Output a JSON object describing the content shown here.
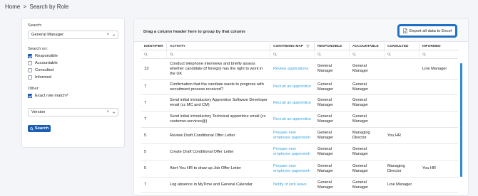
{
  "breadcrumb": {
    "home": "Home",
    "separator": ">",
    "current": "Search by Role"
  },
  "search_panel": {
    "search_label": "Search:",
    "role_select": {
      "value": "General Manager",
      "clear": "×"
    },
    "search_on_label": "Search on:",
    "options": [
      {
        "label": "Responsible",
        "checked": true
      },
      {
        "label": "Accountable",
        "checked": false
      },
      {
        "label": "Consulted",
        "checked": false
      },
      {
        "label": "Informed",
        "checked": false
      }
    ],
    "other_label": "Other:",
    "exact_match": {
      "label": "Exact role match?",
      "checked": true
    },
    "version_select": {
      "value": "Version",
      "clear": "×"
    },
    "search_button": "Search"
  },
  "grid": {
    "group_hint": "Drag a column header here to group by that column",
    "export_label": "Export all data to Excel",
    "columns": [
      "IDENTIFIER",
      "ACTIVITY",
      "CONTAINING MAP",
      "RESPONSIBLE",
      "ACCOUNTABLE",
      "CONSULTED",
      "INFORMED"
    ],
    "rows": [
      {
        "id": "13",
        "activity": "Conduct telephone interviews and briefly assess whether candidate (if foreign) has the right to work in the UK",
        "map": "Review applications",
        "responsible": "General Manager",
        "accountable": "General Manager",
        "consulted": "",
        "informed": "Line Manager"
      },
      {
        "id": "7",
        "activity": "Confirmation that the candiate wants to progress with recruitment process received?",
        "map": "Recruit an apprentice",
        "responsible": "General Manager",
        "accountable": "General Manager",
        "consulted": "",
        "informed": ""
      },
      {
        "id": "7",
        "activity": "Send initial introductory Apprentice Software Developer email (cc MC and CM)",
        "map": "Recruit an apprentice",
        "responsible": "General Manager",
        "accountable": "General Manager",
        "consulted": "",
        "informed": ""
      },
      {
        "id": "7",
        "activity": "Send initial introductory Technical apprentice email (cc customer.services@)",
        "map": "Recruit an apprentice",
        "responsible": "General Manager",
        "accountable": "General Manager",
        "consulted": "",
        "informed": ""
      },
      {
        "id": "5",
        "activity": "Review Draft Conditional Offer Letter",
        "map": "Prepare new employee paperwork",
        "responsible": "General Manager",
        "accountable": "Managing Director",
        "consulted": "You HR",
        "informed": ""
      },
      {
        "id": "5",
        "activity": "Create Draft Conditional Offer Letter",
        "map": "Prepare new employee paperwork",
        "responsible": "General Manager",
        "accountable": "General Manager",
        "consulted": "",
        "informed": ""
      },
      {
        "id": "5",
        "activity": "Alert You HR to draw up Job Offer Letter",
        "map": "Prepare new employee paperwork",
        "responsible": "General Manager",
        "accountable": "General Manager",
        "consulted": "Managing Director",
        "informed": "You HR"
      },
      {
        "id": "7",
        "activity": "Log absence in MyTime and General Calendar",
        "map": "Notify of sick leave",
        "responsible": "General Manager",
        "accountable": "General Manager",
        "consulted": "Line Manager",
        "informed": ""
      }
    ]
  },
  "colors": {
    "accent": "#1a5fb4",
    "link": "#3aa3d9",
    "export_border": "#2270c4",
    "scrollbar": "#2a8fd0"
  },
  "icons": [
    "search-icon",
    "chevron-down-icon",
    "clear-icon",
    "filter-icon",
    "excel-icon",
    "checkbox-icon"
  ]
}
